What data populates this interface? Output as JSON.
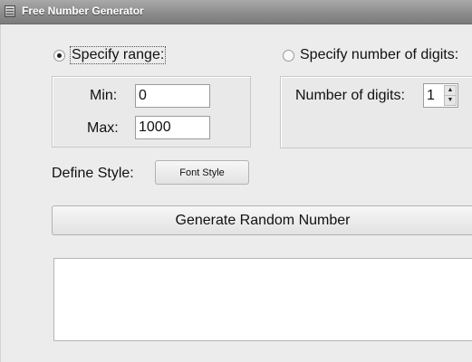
{
  "window": {
    "title": "Free Number Generator"
  },
  "range": {
    "label": "Specify range:",
    "selected": true
  },
  "min": {
    "label": "Min:",
    "value": "0"
  },
  "max": {
    "label": "Max:",
    "value": "1000"
  },
  "digits_option": {
    "label": "Specify number of digits:",
    "selected": false
  },
  "digits": {
    "label": "Number of digits:",
    "value": "1"
  },
  "style": {
    "label": "Define Style:",
    "button": "Font Style"
  },
  "generate_button": "Generate Random Number",
  "output": {
    "value": ""
  }
}
